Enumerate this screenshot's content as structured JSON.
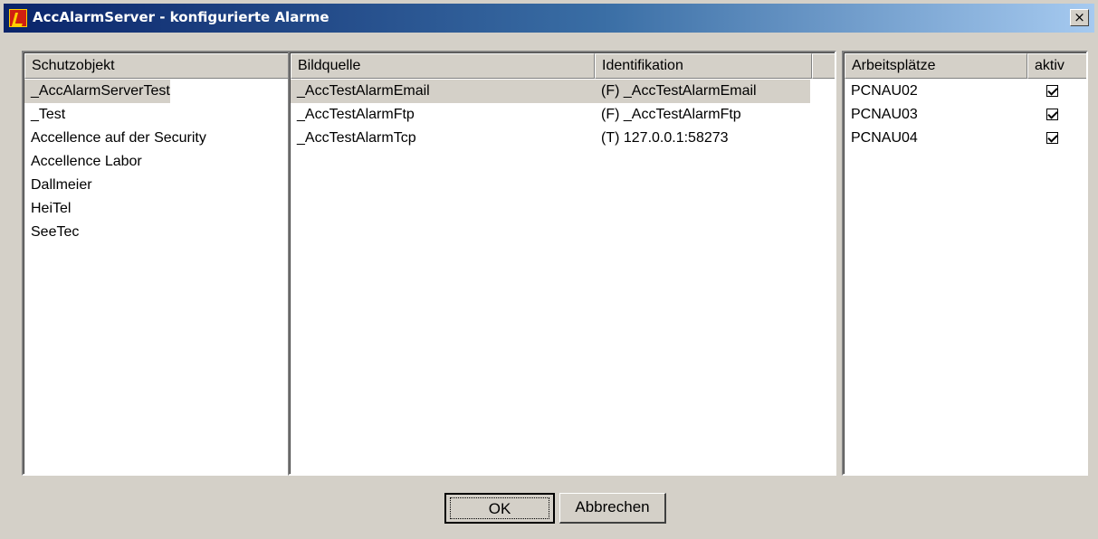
{
  "window": {
    "title": "AccAlarmServer - konfigurierte Alarme",
    "close_label": "×"
  },
  "left": {
    "header": "Schutzobjekt",
    "items": [
      "_AccAlarmServerTest",
      "_Test",
      "Accellence auf der Security",
      "Accellence Labor",
      "Dallmeier",
      "HeiTel",
      "SeeTec"
    ]
  },
  "middle": {
    "headers": {
      "source": "Bildquelle",
      "id": "Identifikation",
      "extra": ""
    },
    "rows": [
      {
        "source": "_AccTestAlarmEmail",
        "id": "(F) _AccTestAlarmEmail"
      },
      {
        "source": "_AccTestAlarmFtp",
        "id": "(F) _AccTestAlarmFtp"
      },
      {
        "source": "_AccTestAlarmTcp",
        "id": "(T) 127.0.0.1:58273"
      }
    ]
  },
  "right": {
    "headers": {
      "workstations": "Arbeitsplätze",
      "active": "aktiv"
    },
    "rows": [
      {
        "name": "PCNAU02",
        "active": true
      },
      {
        "name": "PCNAU03",
        "active": true
      },
      {
        "name": "PCNAU04",
        "active": true
      }
    ]
  },
  "buttons": {
    "ok": "OK",
    "cancel": "Abbrechen"
  }
}
